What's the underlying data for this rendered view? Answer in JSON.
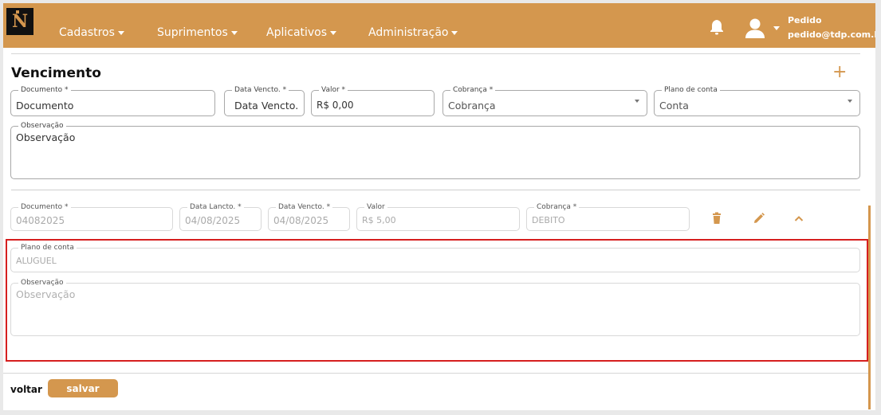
{
  "nav": {
    "menu": [
      "Cadastros",
      "Suprimentos",
      "Aplicativos",
      "Administração"
    ],
    "user_name": "Pedido",
    "user_email": "pedido@tdp.com.br"
  },
  "form": {
    "title": "Vencimento",
    "add_icon": "plus-icon",
    "documento_label": "Documento *",
    "documento_placeholder": "Documento",
    "data_vencto_label": "Data Vencto. *",
    "data_vencto_placeholder": "Data Vencto.",
    "valor_label": "Valor *",
    "valor_value": "R$ 0,00",
    "cobranca_label": "Cobrança *",
    "cobranca_placeholder": "Cobrança",
    "plano_label": "Plano de conta",
    "plano_placeholder": "Conta",
    "observacao_label": "Observação",
    "observacao_placeholder": "Observação"
  },
  "entry": {
    "documento_label": "Documento *",
    "documento_value": "04082025",
    "data_lancto_label": "Data Lancto. *",
    "data_lancto_value": "04/08/2025",
    "data_vencto_label": "Data Vencto. *",
    "data_vencto_value": "04/08/2025",
    "valor_label": "Valor",
    "valor_value": "R$ 5,00",
    "cobranca_label": "Cobrança *",
    "cobranca_value": "DEBITO",
    "plano_label": "Plano de conta",
    "plano_value": "ALUGUEL",
    "observacao_label": "Observação",
    "observacao_placeholder": "Observação",
    "icons": [
      "trash-icon",
      "pencil-icon",
      "chevron-up-icon"
    ]
  },
  "footer": {
    "back_label": "voltar",
    "save_label": "salvar"
  },
  "colors": {
    "brand": "#d4974e",
    "highlight": "#d61f1f"
  }
}
